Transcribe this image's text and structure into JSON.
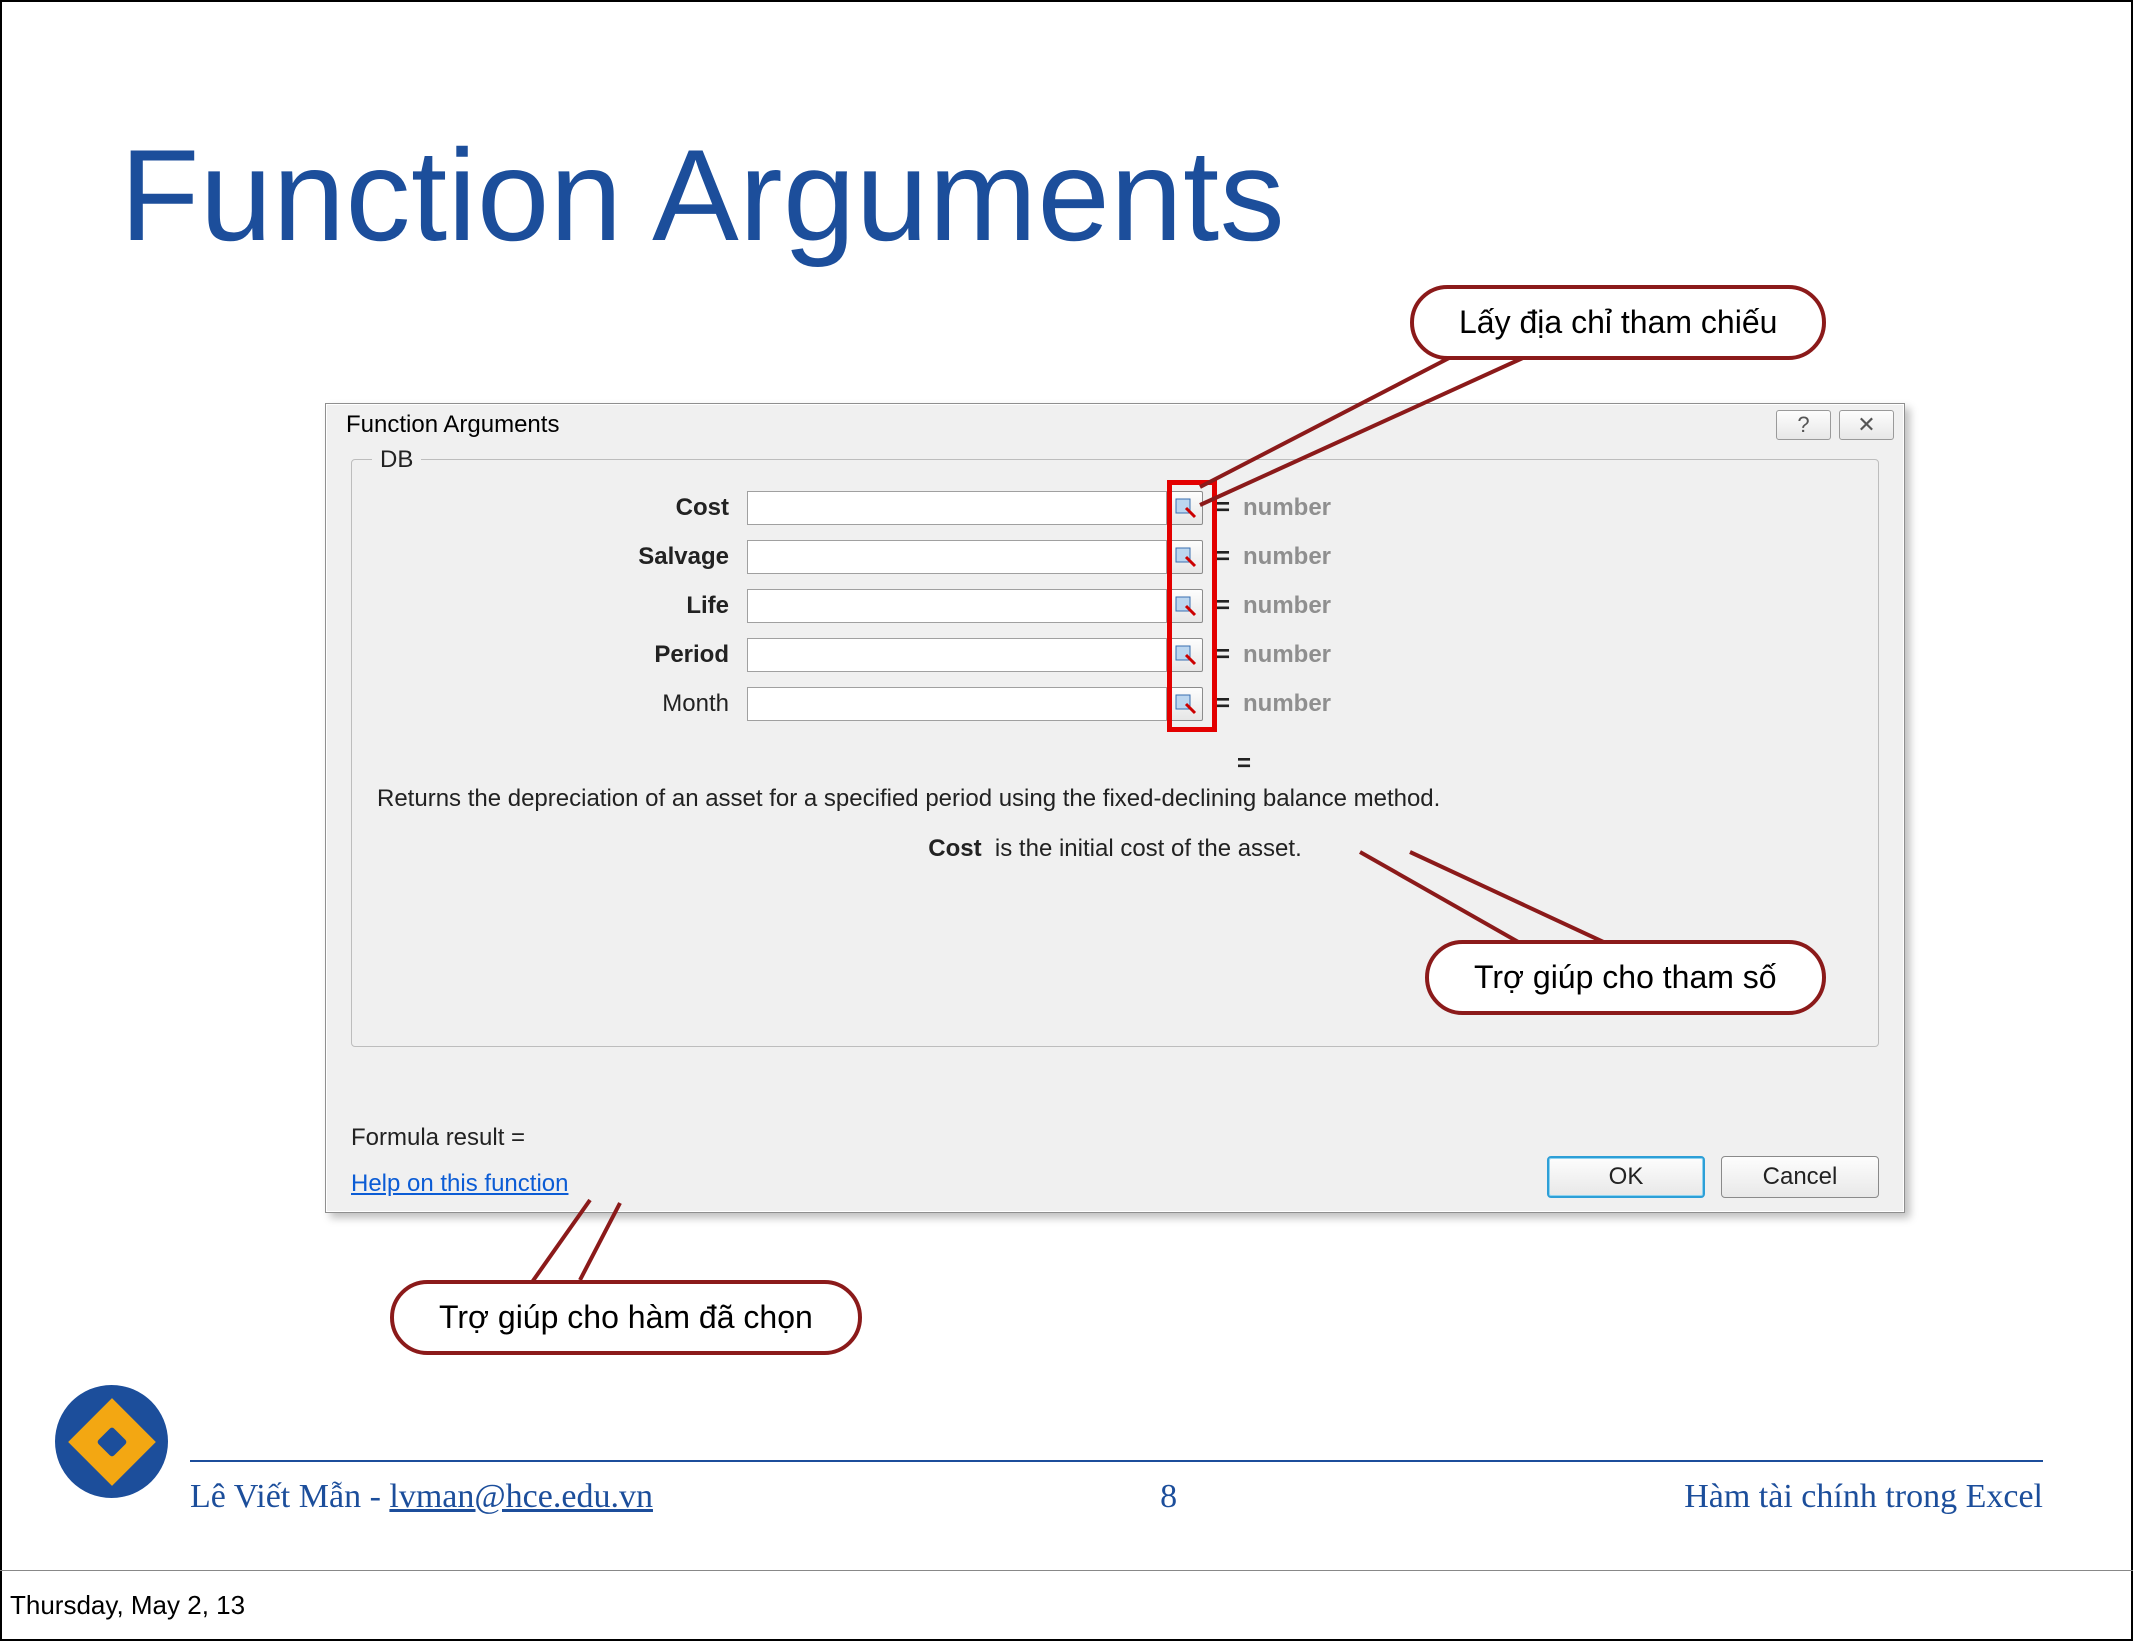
{
  "slide": {
    "title": "Function Arguments"
  },
  "dialog": {
    "caption": "Function Arguments",
    "function_name": "DB",
    "args": [
      {
        "label": "Cost",
        "required": true,
        "type": "number"
      },
      {
        "label": "Salvage",
        "required": true,
        "type": "number"
      },
      {
        "label": "Life",
        "required": true,
        "type": "number"
      },
      {
        "label": "Period",
        "required": true,
        "type": "number"
      },
      {
        "label": "Month",
        "required": false,
        "type": "number"
      }
    ],
    "result_eq": "=",
    "description": "Returns the depreciation of an asset for a specified period using the fixed-declining balance method.",
    "param_help_name": "Cost",
    "param_help_text": "is the initial cost of the asset.",
    "formula_result": "Formula result =",
    "help_link": "Help on this function",
    "ok": "OK",
    "cancel": "Cancel",
    "help_btn": "?",
    "close_btn": "✕"
  },
  "callouts": {
    "ref": "Lấy địa chỉ tham chiếu",
    "param": "Trợ giúp cho tham số",
    "funchelp": "Trợ giúp cho hàm đã chọn"
  },
  "footer": {
    "author": "Lê Viết Mẫn - ",
    "email": "lvman@hce.edu.vn",
    "page": "8",
    "topic": "Hàm tài chính trong Excel"
  },
  "timestamp": "Thursday, May 2, 13"
}
